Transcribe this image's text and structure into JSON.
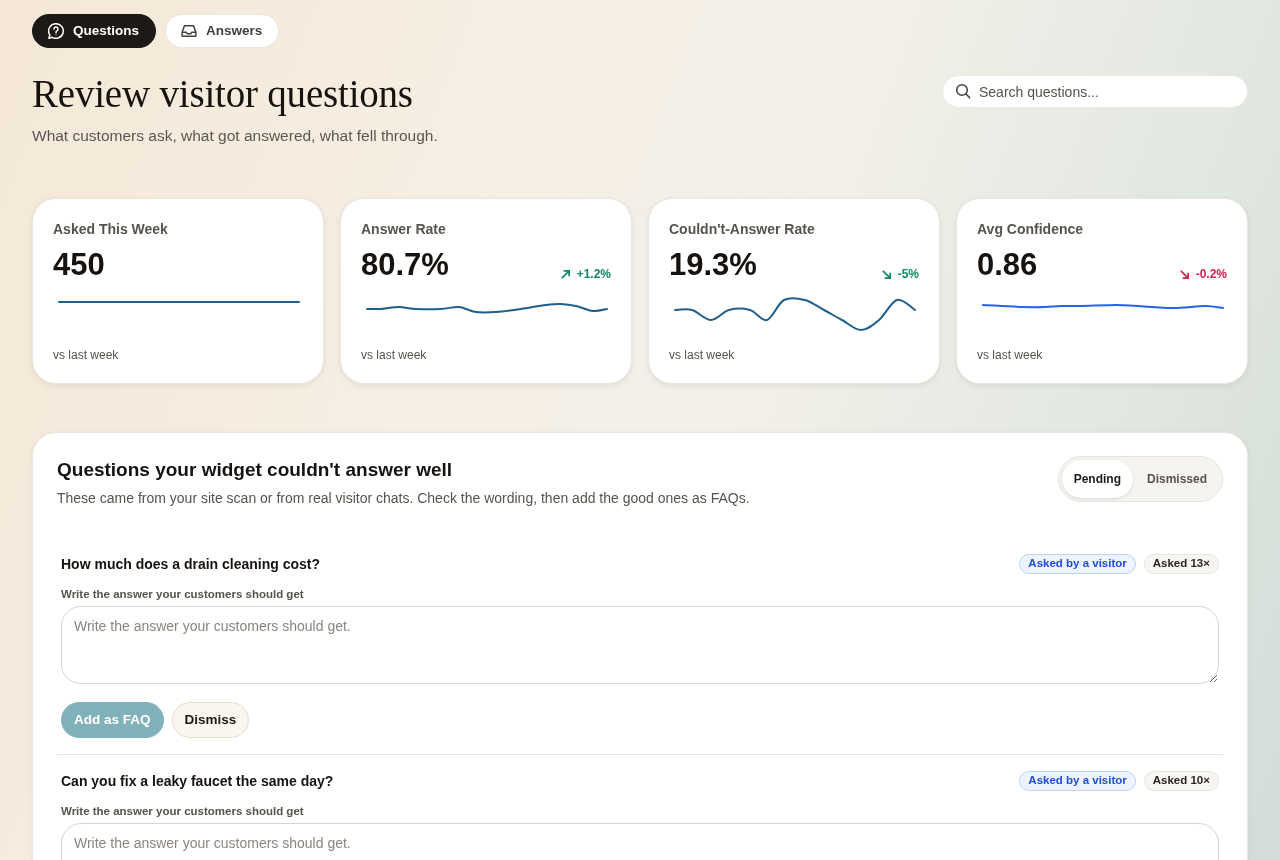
{
  "nav_tabs": [
    {
      "label": "Questions",
      "selected": true
    },
    {
      "label": "Answers",
      "selected": false
    }
  ],
  "header": {
    "title": "Review visitor questions",
    "subtitle": "What customers ask, what got answered, what fell through."
  },
  "search": {
    "placeholder": "Search questions..."
  },
  "stats": [
    {
      "label": "Asked This Week",
      "value": "450",
      "footnote": "vs last week"
    },
    {
      "label": "Answer Rate",
      "value": "80.7%",
      "delta": {
        "text": "+1.2%",
        "kind": "rise",
        "color": "#0f8a5f"
      },
      "footnote": "vs last week"
    },
    {
      "label": "Couldn't-Answer Rate",
      "value": "19.3%",
      "delta": {
        "text": "-5%",
        "kind": "fall",
        "color": "#0f8a5f"
      },
      "footnote": "vs last week"
    },
    {
      "label": "Avg Confidence",
      "value": "0.86",
      "delta": {
        "text": "-0.2%",
        "kind": "fall",
        "color": "#d6204e"
      },
      "footnote": "vs last week"
    }
  ],
  "review_panel": {
    "title": "Questions your widget couldn't answer well",
    "description": "These came from your site scan or from real visitor chats. Check the wording, then add the good ones as FAQs.",
    "filter_tabs": [
      {
        "label": "Pending",
        "selected": true
      },
      {
        "label": "Dismissed",
        "selected": false
      }
    ],
    "questions": [
      {
        "question": "How much does a drain cleaning cost?",
        "badges": [
          {
            "kind": "source",
            "text": "Asked by a visitor"
          },
          {
            "kind": "count",
            "text": "Asked 13×"
          }
        ],
        "answer_label": "Write the answer your customers should get",
        "answer": {
          "placeholder": "Write the answer your customers should get."
        },
        "actions": [
          {
            "kind": "primary",
            "label": "Add as FAQ",
            "disabled": true
          },
          {
            "kind": "secondary",
            "label": "Dismiss"
          }
        ]
      },
      {
        "question": "Can you fix a leaky faucet the same day?",
        "badges": [
          {
            "kind": "source",
            "text": "Asked by a visitor"
          },
          {
            "kind": "count",
            "text": "Asked 10×"
          }
        ],
        "answer_label": "Write the answer your customers should get",
        "answer": {
          "placeholder": "Write the answer your customers should get."
        }
      }
    ]
  }
}
